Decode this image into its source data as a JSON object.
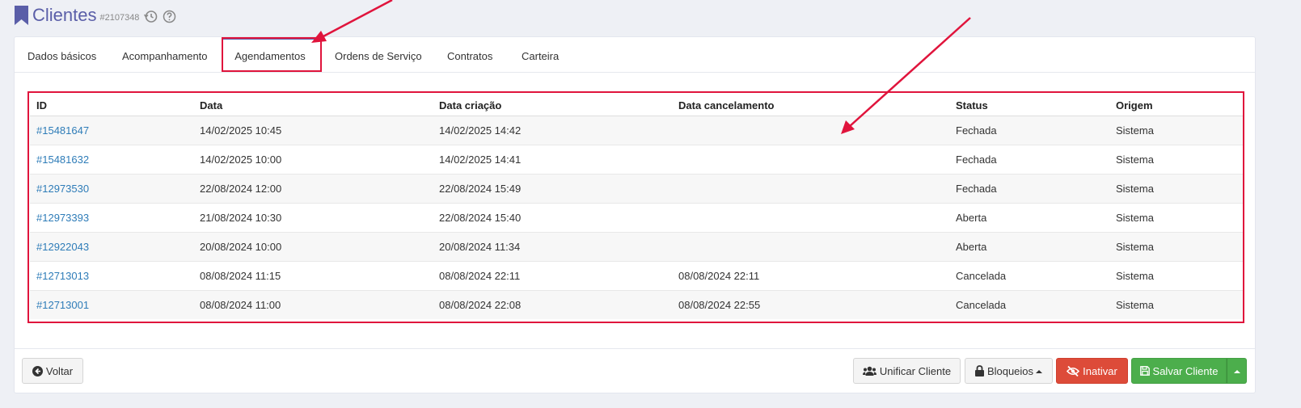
{
  "header": {
    "title": "Clientes",
    "record_id": "#2107348"
  },
  "tabs": [
    {
      "label": "Dados básicos",
      "active": false
    },
    {
      "label": "Acompanhamento",
      "active": false
    },
    {
      "label": "Agendamentos",
      "active": true
    },
    {
      "label": "Ordens de Serviço",
      "active": false
    },
    {
      "label": "Contratos",
      "active": false
    },
    {
      "label": "Carteira",
      "active": false
    }
  ],
  "table": {
    "columns": [
      "ID",
      "Data",
      "Data criação",
      "Data cancelamento",
      "Status",
      "Origem"
    ],
    "rows": [
      {
        "id": "#15481647",
        "data": "14/02/2025 10:45",
        "criacao": "14/02/2025 14:42",
        "cancelamento": "",
        "status": "Fechada",
        "origem": "Sistema"
      },
      {
        "id": "#15481632",
        "data": "14/02/2025 10:00",
        "criacao": "14/02/2025 14:41",
        "cancelamento": "",
        "status": "Fechada",
        "origem": "Sistema"
      },
      {
        "id": "#12973530",
        "data": "22/08/2024 12:00",
        "criacao": "22/08/2024 15:49",
        "cancelamento": "",
        "status": "Fechada",
        "origem": "Sistema"
      },
      {
        "id": "#12973393",
        "data": "21/08/2024 10:30",
        "criacao": "22/08/2024 15:40",
        "cancelamento": "",
        "status": "Aberta",
        "origem": "Sistema"
      },
      {
        "id": "#12922043",
        "data": "20/08/2024 10:00",
        "criacao": "20/08/2024 11:34",
        "cancelamento": "",
        "status": "Aberta",
        "origem": "Sistema"
      },
      {
        "id": "#12713013",
        "data": "08/08/2024 11:15",
        "criacao": "08/08/2024 22:11",
        "cancelamento": "08/08/2024 22:11",
        "status": "Cancelada",
        "origem": "Sistema"
      },
      {
        "id": "#12713001",
        "data": "08/08/2024 11:00",
        "criacao": "08/08/2024 22:08",
        "cancelamento": "08/08/2024 22:55",
        "status": "Cancelada",
        "origem": "Sistema"
      }
    ]
  },
  "footer": {
    "back_label": "Voltar",
    "merge_label": "Unificar Cliente",
    "blocks_label": "Bloqueios",
    "deactivate_label": "Inativar",
    "save_label": "Salvar Cliente"
  },
  "colors": {
    "accent": "#5a5ea8",
    "link": "#2e7cb8",
    "annotation": "#e0143c",
    "danger": "#dd4b39",
    "success": "#4cae4c"
  },
  "icons": [
    "bookmark-icon",
    "history-icon",
    "help-icon",
    "arrow-left-circle-icon",
    "users-icon",
    "lock-icon",
    "eye-slash-icon",
    "floppy-disk-icon",
    "caret-up-icon"
  ]
}
